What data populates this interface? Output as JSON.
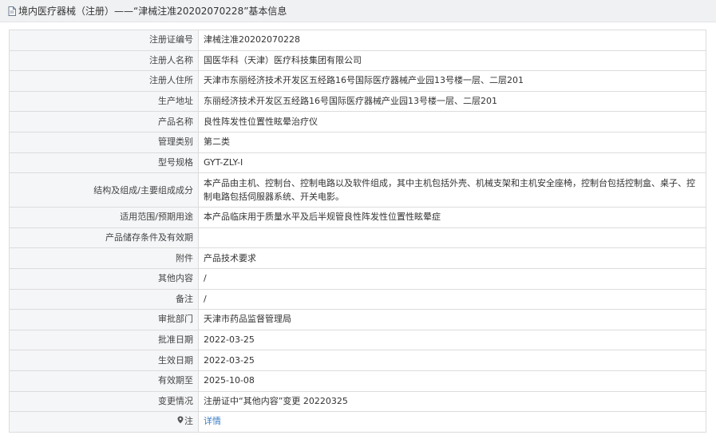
{
  "header": {
    "title": "境内医疗器械（注册）——“津械注准20202070228”基本信息"
  },
  "rows": [
    {
      "label": "注册证编号",
      "value": "津械注准20202070228"
    },
    {
      "label": "注册人名称",
      "value": "国医华科（天津）医疗科技集团有限公司"
    },
    {
      "label": "注册人住所",
      "value": "天津市东丽经济技术开发区五经路16号国际医疗器械产业园13号楼一层、二层201"
    },
    {
      "label": "生产地址",
      "value": "东丽经济技术开发区五经路16号国际医疗器械产业园13号楼一层、二层201"
    },
    {
      "label": "产品名称",
      "value": "良性阵发性位置性眩晕治疗仪"
    },
    {
      "label": "管理类别",
      "value": "第二类"
    },
    {
      "label": "型号规格",
      "value": "GYT-ZLY-I"
    },
    {
      "label": "结构及组成/主要组成成分",
      "value": "本产品由主机、控制台、控制电路以及软件组成，其中主机包括外壳、机械支架和主机安全座椅，控制台包括控制盒、桌子、控制电路包括伺服器系统、开关电影。"
    },
    {
      "label": "适用范围/预期用途",
      "value": "本产品临床用于质量水平及后半规管良性阵发性位置性眩晕症"
    },
    {
      "label": "产品储存条件及有效期",
      "value": ""
    },
    {
      "label": "附件",
      "value": "产品技术要求"
    },
    {
      "label": "其他内容",
      "value": "/"
    },
    {
      "label": "备注",
      "value": "/"
    },
    {
      "label": "审批部门",
      "value": "天津市药品监督管理局"
    },
    {
      "label": "批准日期",
      "value": "2022-03-25"
    },
    {
      "label": "生效日期",
      "value": "2022-03-25"
    },
    {
      "label": "有效期至",
      "value": "2025-10-08"
    },
    {
      "label": "变更情况",
      "value": "注册证中“其他内容”变更 20220325"
    }
  ],
  "note_row": {
    "label": "注",
    "link_text": "详情"
  },
  "colors": {
    "label_bg": "#f5f6f8",
    "border": "#dcdcdc",
    "link": "#3a7cc4",
    "title_bg": "#f0f1f3"
  }
}
